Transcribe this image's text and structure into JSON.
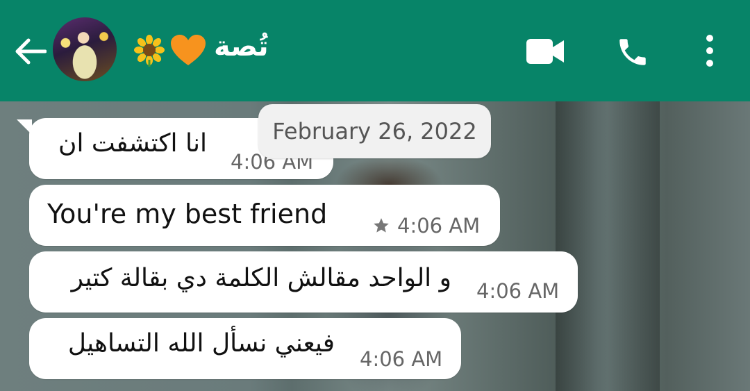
{
  "header": {
    "contact_name": "تُصة",
    "status_emojis": [
      "sunflower-icon",
      "orange-heart-icon"
    ],
    "background_color": "#078468"
  },
  "date_separator": "February 26, 2022",
  "messages": [
    {
      "text": "انا اكتشفت ان",
      "time": "4:06 AM",
      "starred": false
    },
    {
      "text": "You're my best friend",
      "time": "4:06 AM",
      "starred": true
    },
    {
      "text": "و الواحد مقالش الكلمة دي بقالة كتير",
      "time": "4:06 AM",
      "starred": false
    },
    {
      "text": "فيعني نسأل الله التساهيل",
      "time": "4:06 AM",
      "starred": false
    }
  ],
  "colors": {
    "bubble": "#ffffff",
    "date_chip": "#f1f1f1",
    "time_text": "#666666"
  }
}
